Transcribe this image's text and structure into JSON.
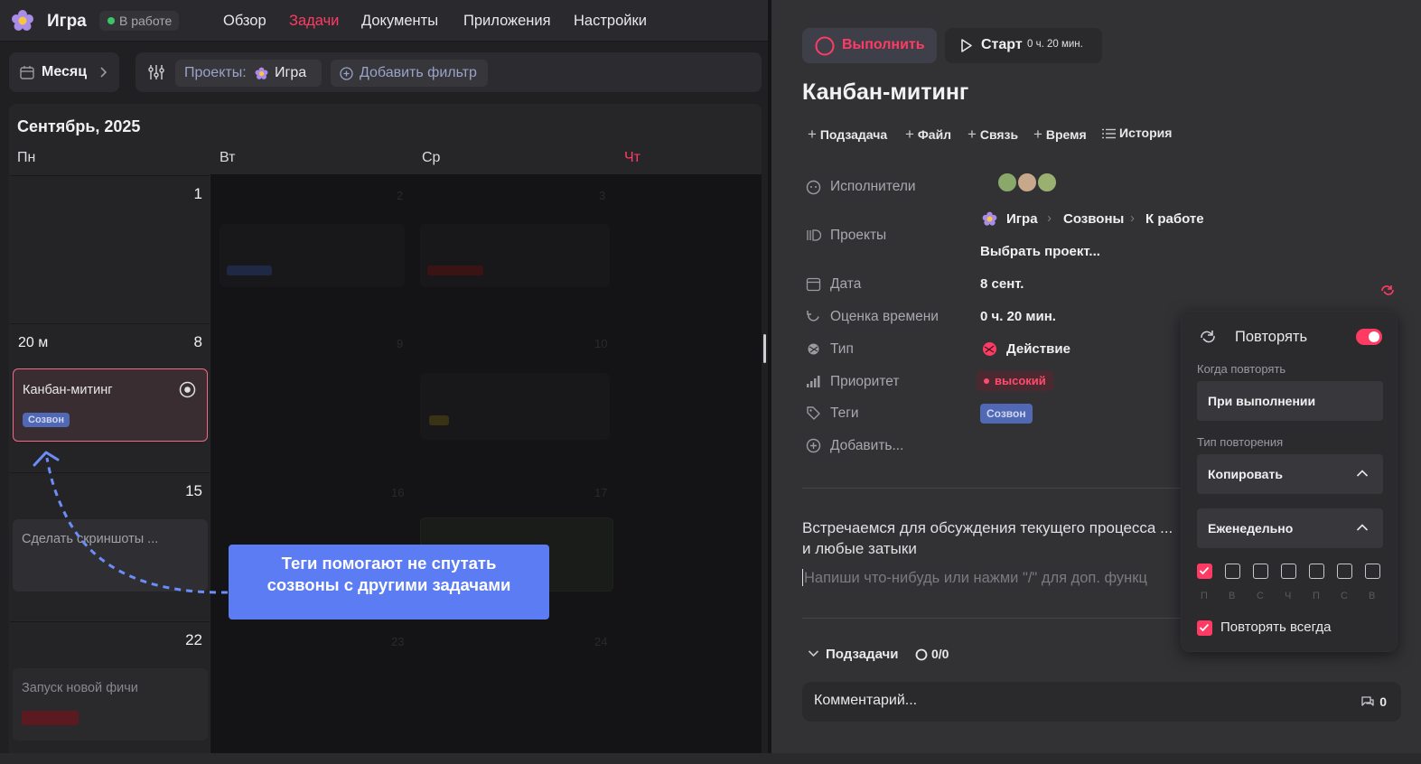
{
  "header": {
    "app_title": "Игра",
    "status": "В работе",
    "nav": [
      "Обзор",
      "Задачи",
      "Документы",
      "Приложения",
      "Настройки"
    ],
    "active_nav": "Задачи",
    "accent_color": "#ff3b64"
  },
  "toolbar": {
    "view_label": "Месяц",
    "projects_prefix": "Проекты:",
    "project_name": "Игра",
    "add_filter": "Добавить фильтр"
  },
  "calendar": {
    "month_title": "Сентябрь, 2025",
    "weekdays": [
      "Пн",
      "Вт",
      "Ср",
      "Чт"
    ],
    "cells": [
      {
        "day": "1",
        "label": ""
      },
      {
        "day": "8",
        "label": "20 м"
      },
      {
        "day": "15",
        "label": ""
      },
      {
        "day": "22",
        "label": ""
      }
    ],
    "tasks": [
      {
        "title": "Канбан-митинг",
        "tag": "Созвон"
      },
      {
        "title": "Сделать скриншоты ..."
      },
      {
        "title": "Запуск новой фичи"
      }
    ]
  },
  "tooltip": {
    "line1": "Теги помогают не спутать",
    "line2": "созвоны с другими задачами"
  },
  "task_panel": {
    "complete_button": "Выполнить",
    "start_button": "Старт",
    "start_time": "0 ч. 20 мин.",
    "title": "Канбан-митинг",
    "actions": [
      "Подзадача",
      "Файл",
      "Связь",
      "Время",
      "История"
    ],
    "props": {
      "assignees_label": "Исполнители",
      "projects_label": "Проекты",
      "project_path": [
        "Игра",
        "Созвоны",
        "К работе"
      ],
      "choose_project": "Выбрать проект...",
      "date_label": "Дата",
      "date_value": "8 сент.",
      "estimate_label": "Оценка времени",
      "estimate_value": "0 ч. 20 мин.",
      "type_label": "Тип",
      "type_value": "Действие",
      "priority_label": "Приоритет",
      "priority_value": "высокий",
      "tags_label": "Теги",
      "tags_value": "Созвон",
      "add_label": "Добавить..."
    },
    "description_line1": "Встречаемся для обсуждения текущего процесса ...",
    "description_line2": "и любые затыки",
    "editor_placeholder": "Напиши что-нибудь или нажми \"/\" для доп. функц",
    "subtasks_label": "Подзадачи",
    "subtasks_count": "0/0",
    "comment_placeholder": "Комментарий...",
    "comment_count": "0"
  },
  "repeat_popup": {
    "title": "Повторять",
    "enabled": true,
    "when_label": "Когда повторять",
    "when_value": "При выполнении",
    "type_label": "Тип повторения",
    "type_value": "Копировать",
    "frequency": "Еженедельно",
    "weekday_letters": [
      "П",
      "В",
      "С",
      "Ч",
      "П",
      "С",
      "В"
    ],
    "weekday_checked": [
      true,
      false,
      false,
      false,
      false,
      false,
      false
    ],
    "repeat_always_label": "Повторять всегда",
    "repeat_always": true
  }
}
